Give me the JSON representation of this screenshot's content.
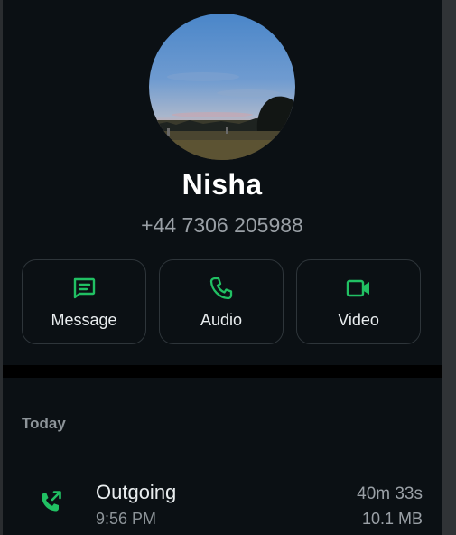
{
  "contact": {
    "name": "Nisha",
    "phone": "+44 7306 205988",
    "avatar_icon": "profile-photo-sunset"
  },
  "actions": [
    {
      "label": "Message",
      "icon": "message-icon"
    },
    {
      "label": "Audio",
      "icon": "phone-icon"
    },
    {
      "label": "Video",
      "icon": "video-camera-icon"
    }
  ],
  "call_log": {
    "section_title": "Today",
    "entries": [
      {
        "type": "Outgoing",
        "time": "9:56 PM",
        "duration": "40m 33s",
        "size": "10.1 MB",
        "icon": "outgoing-call-icon"
      }
    ]
  },
  "colors": {
    "accent": "#21c063",
    "background": "#0b1014",
    "text_primary": "#e9edef",
    "text_secondary": "#8d9499"
  }
}
